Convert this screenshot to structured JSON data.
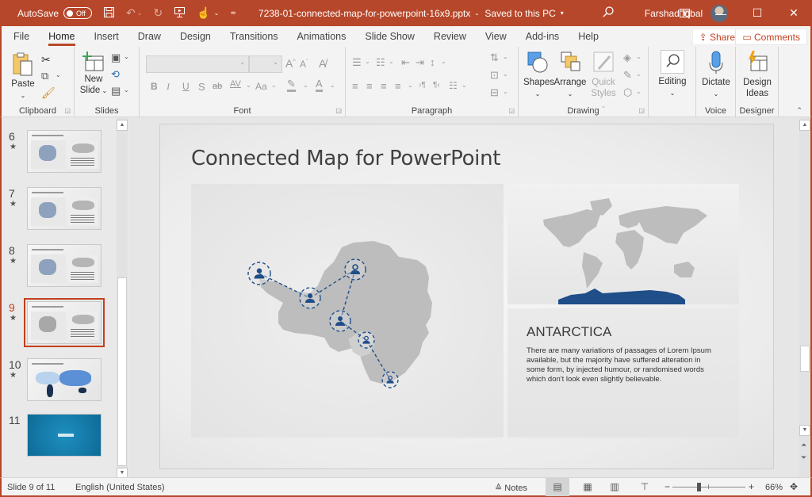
{
  "titlebar": {
    "autosave_label": "AutoSave",
    "autosave_state": "Off",
    "doc_title": "7238-01-connected-map-for-powerpoint-16x9.pptx",
    "separator": "-",
    "saved_status": "Saved to this PC",
    "user_name": "Farshad Iqbal",
    "icons": [
      "save-icon",
      "undo-icon",
      "redo-icon",
      "present-icon",
      "touch-mode-icon",
      "customize-icon"
    ]
  },
  "tabs": [
    {
      "label": "File"
    },
    {
      "label": "Home",
      "active": true
    },
    {
      "label": "Insert"
    },
    {
      "label": "Draw"
    },
    {
      "label": "Design"
    },
    {
      "label": "Transitions"
    },
    {
      "label": "Animations"
    },
    {
      "label": "Slide Show"
    },
    {
      "label": "Review"
    },
    {
      "label": "View"
    },
    {
      "label": "Add-ins"
    },
    {
      "label": "Help"
    }
  ],
  "share_label": "Share",
  "comments_label": "Comments",
  "ribbon": {
    "clipboard": {
      "label": "Clipboard",
      "paste": "Paste"
    },
    "slides": {
      "label": "Slides",
      "new_slide_line1": "New",
      "new_slide_line2": "Slide"
    },
    "font": {
      "label": "Font",
      "font_name": "",
      "font_size": "",
      "bold": "B",
      "italic": "I",
      "underline": "U",
      "shadow": "S",
      "strike": "ab",
      "spacing": "AV",
      "case": "Aa",
      "grow": "A",
      "shrink": "A"
    },
    "paragraph": {
      "label": "Paragraph"
    },
    "drawing": {
      "label": "Drawing",
      "shapes": "Shapes",
      "arrange": "Arrange",
      "quick_styles_line1": "Quick",
      "quick_styles_line2": "Styles"
    },
    "editing": {
      "label": "Editing"
    },
    "voice": {
      "label": "Voice",
      "dictate": "Dictate"
    },
    "designer": {
      "label": "Designer",
      "design_ideas_line1": "Design",
      "design_ideas_line2": "Ideas"
    }
  },
  "slides_pane": [
    {
      "num": "6",
      "star": "★",
      "kind": "africa"
    },
    {
      "num": "7",
      "star": "★",
      "kind": "asia"
    },
    {
      "num": "8",
      "star": "★",
      "kind": "oceania"
    },
    {
      "num": "9",
      "star": "★",
      "kind": "antarctica",
      "current": true
    },
    {
      "num": "10",
      "star": "★",
      "kind": "world"
    },
    {
      "num": "11",
      "star": "",
      "kind": "closing"
    }
  ],
  "slide": {
    "title": "Connected Map for PowerPoint",
    "region_title": "ANTARCTICA",
    "region_body": "There are many variations of passages of Lorem Ipsum available, but the majority have suffered alteration in some form, by injected humour, or randomised words which don't look even slightly believable.",
    "highlight_color": "#1f4e89",
    "map_gray": "#bdbdbd",
    "connection_nodes": [
      {
        "icon": "male-user-icon"
      },
      {
        "icon": "male-user-icon"
      },
      {
        "icon": "female-user-icon"
      },
      {
        "icon": "male-user-icon"
      },
      {
        "icon": "female-user-icon"
      },
      {
        "icon": "female-user-icon"
      }
    ]
  },
  "status": {
    "slide_counter": "Slide 9 of 11",
    "language": "English (United States)",
    "notes": "Notes",
    "zoom_level": "66%",
    "zoom_minus": "−",
    "zoom_plus": "+"
  }
}
